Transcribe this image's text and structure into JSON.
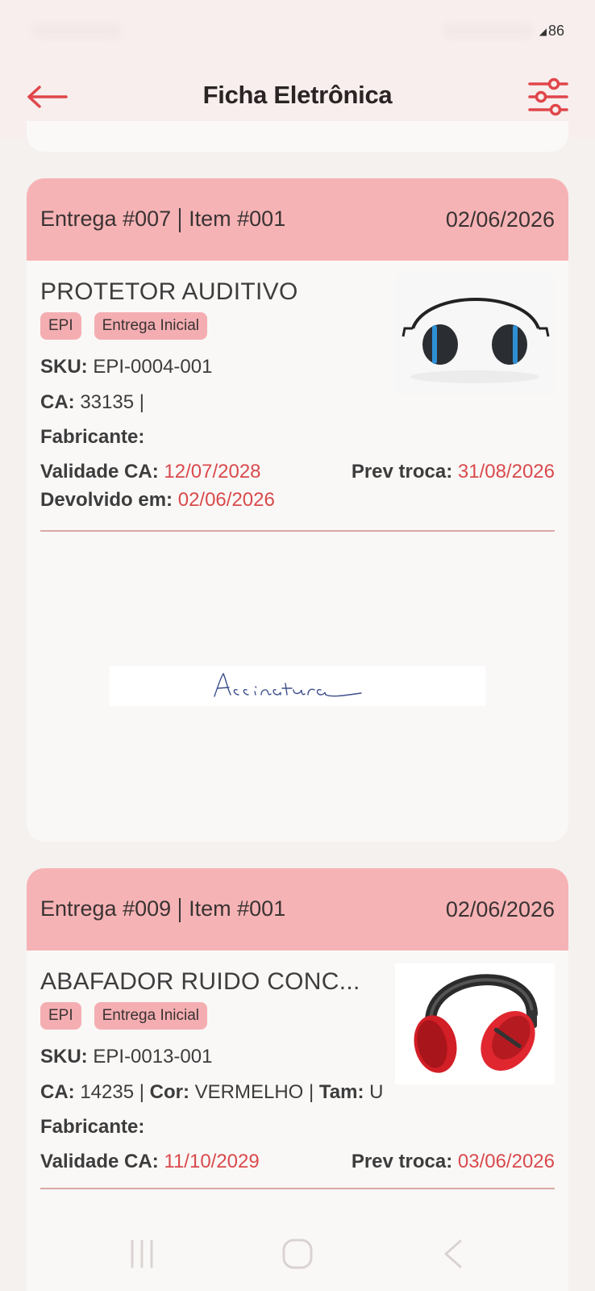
{
  "status_bar": {
    "battery": "86"
  },
  "header": {
    "title": "Ficha Eletrônica",
    "back_icon": "arrow-left-icon",
    "filter_icon": "sliders-icon"
  },
  "colors": {
    "accent": "#d94a4c",
    "card_header": "#f6b3b5",
    "badge": "#f4aeb2"
  },
  "cards": [
    {
      "entrega": "Entrega #007",
      "item": "Item #001",
      "date": "02/06/2026",
      "product": "PROTETOR AUDITIVO",
      "badges": [
        "EPI",
        "Entrega Inicial"
      ],
      "sku_label": "SKU:",
      "sku": "EPI-0004-001",
      "ca_label": "CA:",
      "ca": "33135 |",
      "fabricante_label": "Fabricante:",
      "validade_label": "Validade CA:",
      "validade": "12/07/2028",
      "prev_troca_label": "Prev troca:",
      "prev_troca": "31/08/2026",
      "devolvido_label": "Devolvido em:",
      "devolvido": "02/06/2026",
      "signature": "Assinatura"
    },
    {
      "entrega": "Entrega #009",
      "item": "Item #001",
      "date": "02/06/2026",
      "product": "ABAFADOR RUIDO CONC...",
      "badges": [
        "EPI",
        "Entrega Inicial"
      ],
      "sku_label": "SKU:",
      "sku": "EPI-0013-001",
      "ca_label": "CA:",
      "ca": "14235 |",
      "cor_label": "Cor:",
      "cor": "VERMELHO |",
      "tam_label": "Tam:",
      "tam": "U",
      "fabricante_label": "Fabricante:",
      "validade_label": "Validade CA:",
      "validade": "11/10/2029",
      "prev_troca_label": "Prev troca:",
      "prev_troca": "03/06/2026"
    }
  ],
  "nav": {
    "recents_icon": "recents-icon",
    "home_icon": "home-icon",
    "back_icon": "nav-back-icon"
  }
}
